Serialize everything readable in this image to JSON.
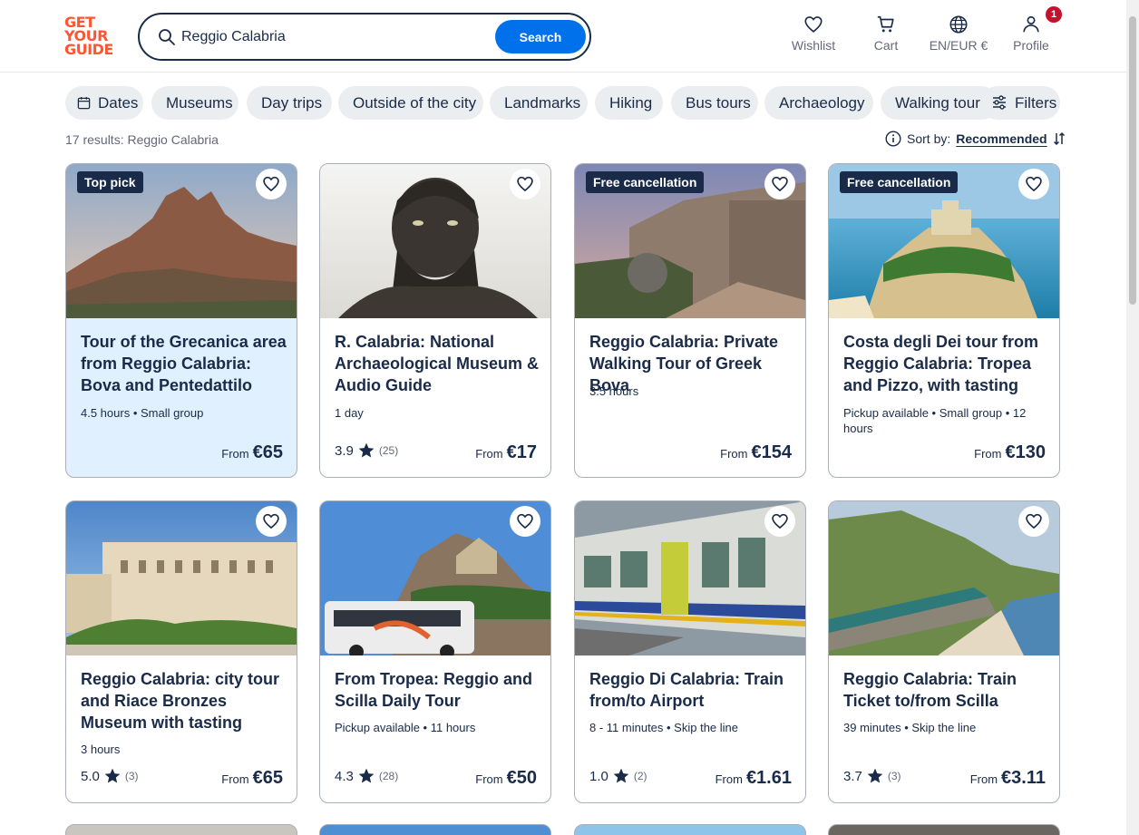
{
  "logo": {
    "lines": [
      "GET",
      "YOUR",
      "GUIDE"
    ]
  },
  "search": {
    "value": "Reggio Calabria",
    "button_label": "Search"
  },
  "nav": {
    "wishlist": "Wishlist",
    "cart": "Cart",
    "language": "EN/EUR €",
    "profile": "Profile",
    "profile_badge": "1"
  },
  "chips": [
    "Dates",
    "Museums",
    "Day trips",
    "Outside of the city",
    "Landmarks",
    "Hiking",
    "Bus tours",
    "Archaeology",
    "Walking tours"
  ],
  "filters_label": "Filters",
  "results_text": "17 results: Reggio Calabria",
  "sort": {
    "label": "Sort by:",
    "value": "Recommended"
  },
  "colors": {
    "brand": "#ff5533",
    "accent": "#0071eb",
    "text": "#1a2b49",
    "top_pick_bg": "#e0f0ff",
    "badge": "#c8102e"
  },
  "cards": [
    {
      "tag": "Top pick",
      "title": "Tour of the Grecanica area from Reggio Calabria: Bova and Pentedattilo",
      "meta": "4.5 hours • Small group",
      "rating": "",
      "reviews": "",
      "from": "From",
      "price": "€65"
    },
    {
      "tag": "",
      "title": "R. Calabria: National Archaeological Museum & Audio Guide",
      "meta": "1 day",
      "rating": "3.9",
      "reviews": "(25)",
      "from": "From",
      "price": "€17"
    },
    {
      "tag": "Free cancellation",
      "title": "Reggio Calabria: Private Walking Tour of Greek Bova",
      "meta": "3.5 hours",
      "rating": "",
      "reviews": "",
      "from": "From",
      "price": "€154"
    },
    {
      "tag": "Free cancellation",
      "title": "Costa degli Dei tour from Reggio Calabria: Tropea and Pizzo, with tasting",
      "meta": "Pickup available • Small group • 12 hours",
      "rating": "",
      "reviews": "",
      "from": "From",
      "price": "€130"
    },
    {
      "tag": "",
      "title": "Reggio Calabria: city tour and Riace Bronzes Museum with tasting",
      "meta": "3 hours",
      "rating": "5.0",
      "reviews": "(3)",
      "from": "From",
      "price": "€65"
    },
    {
      "tag": "",
      "title": "From Tropea: Reggio and Scilla Daily Tour",
      "meta": "Pickup available • 11 hours",
      "rating": "4.3",
      "reviews": "(28)",
      "from": "From",
      "price": "€50"
    },
    {
      "tag": "",
      "title": "Reggio Di Calabria: Train from/to Airport",
      "meta": "8 - 11 minutes • Skip the line",
      "rating": "1.0",
      "reviews": "(2)",
      "from": "From",
      "price": "€1.61"
    },
    {
      "tag": "",
      "title": "Reggio Calabria: Train Ticket to/from Scilla",
      "meta": "39 minutes • Skip the line",
      "rating": "3.7",
      "reviews": "(3)",
      "from": "From",
      "price": "€3.11"
    }
  ]
}
